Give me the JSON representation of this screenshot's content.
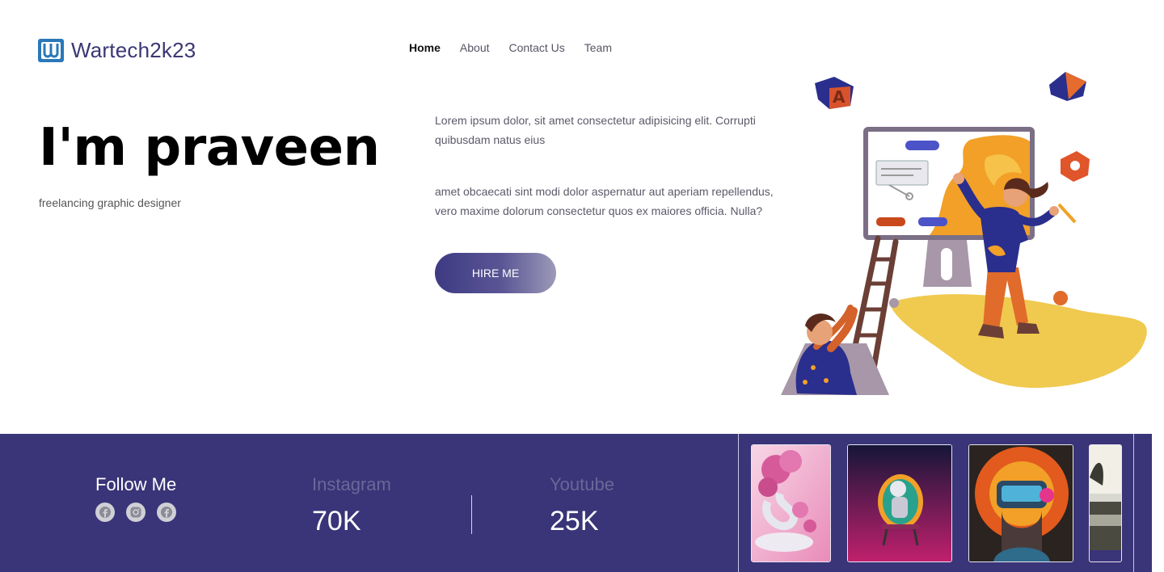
{
  "brand": {
    "name": "Wartech2k23",
    "accent": "#3a3478"
  },
  "nav": {
    "items": [
      {
        "label": "Home",
        "active": true
      },
      {
        "label": "About",
        "active": false
      },
      {
        "label": "Contact Us",
        "active": false
      },
      {
        "label": "Team",
        "active": false
      }
    ]
  },
  "hero": {
    "title": "I'm praveen",
    "subtitle": "freelancing graphic designer",
    "paragraph1": "Lorem ipsum dolor, sit amet consectetur adipisicing elit. Corrupti quibusdam natus eius",
    "paragraph2": "amet obcaecati sint modi dolor aspernatur aut aperiam repellendus, vero maxime dolorum consectetur quos ex maiores officia. Nulla?",
    "cta_label": "HIRE ME",
    "illustration_icon": "designer-illustration"
  },
  "follow": {
    "title": "Follow Me",
    "icons": [
      "facebook-icon",
      "instagram-icon",
      "facebook-icon"
    ]
  },
  "stats": [
    {
      "label": "Instagram",
      "value": "70K"
    },
    {
      "label": "Youtube",
      "value": "25K"
    }
  ],
  "gallery": {
    "items": [
      "floral-spiral-art",
      "astronaut-chair-art",
      "vr-headset-art",
      "landscape-art"
    ]
  }
}
